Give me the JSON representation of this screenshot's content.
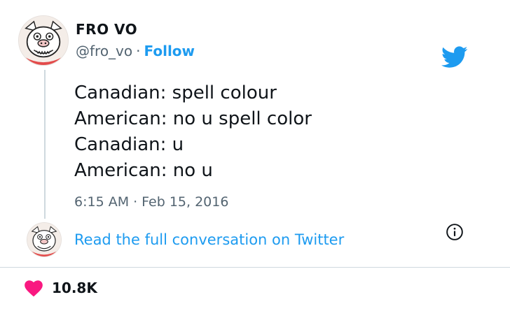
{
  "author": {
    "display_name": "FRO VO",
    "handle": "@fro_vo",
    "separator": "·",
    "follow_label": "Follow"
  },
  "tweet": {
    "lines": [
      "Canadian: spell colour",
      "American: no u spell color",
      "Canadian: u",
      "American: no u"
    ],
    "time": "6:15 AM",
    "separator": "·",
    "date": "Feb 15, 2016"
  },
  "conversation": {
    "link_label": "Read the full conversation on Twitter"
  },
  "engagement": {
    "likes": "10.8K"
  },
  "icons": {
    "brand": "twitter-bird-icon",
    "info": "info-icon",
    "like": "heart-icon",
    "avatar": "avatar"
  },
  "colors": {
    "accent": "#1d9bf0",
    "heart": "#f91880",
    "text": "#0f1419",
    "muted": "#536471",
    "border": "#cfd9de"
  }
}
